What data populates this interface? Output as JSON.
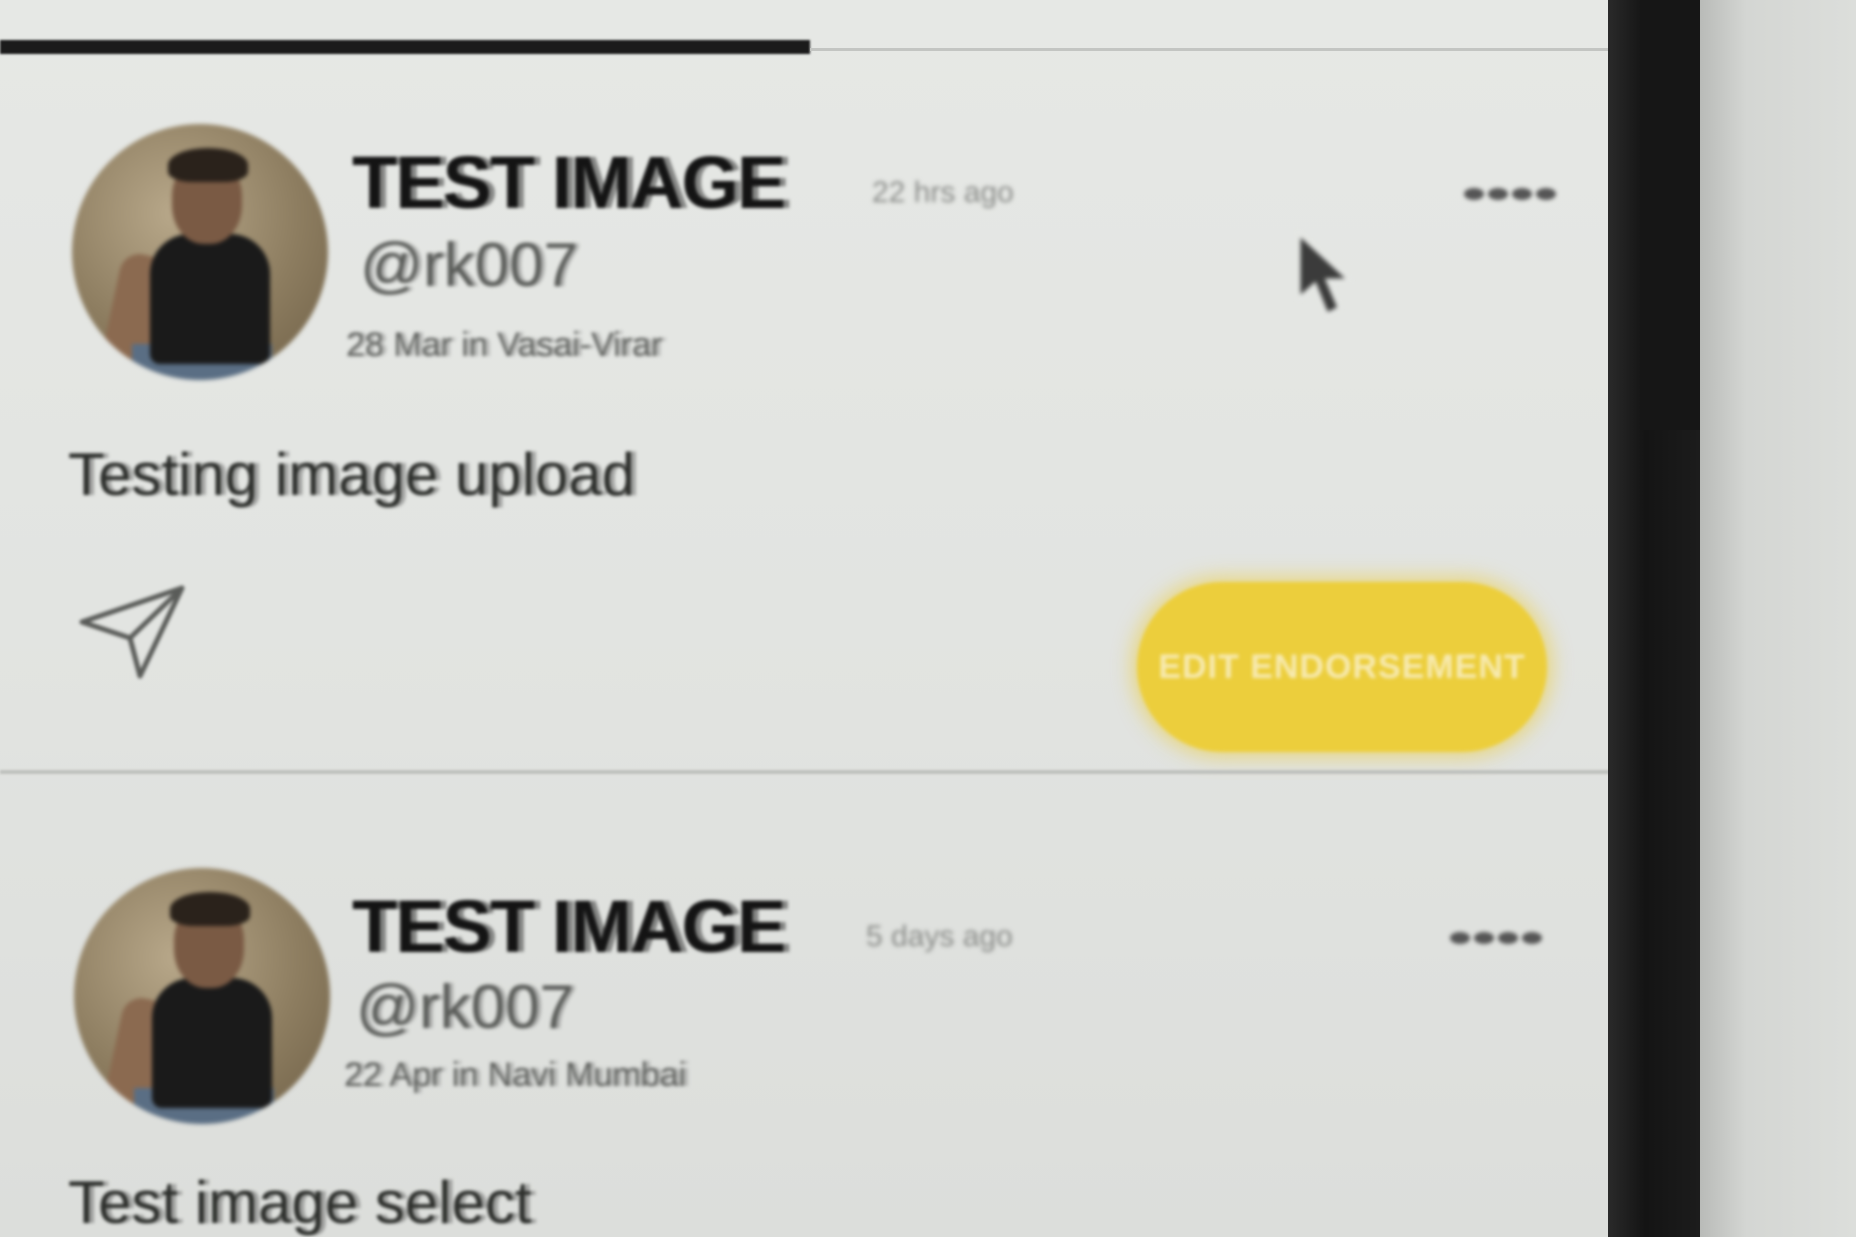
{
  "feed": {
    "posts": [
      {
        "name": "TEST IMAGE",
        "time": "22 hrs ago",
        "handle": "@rk007",
        "meta": "28 Mar in Vasai-Virar",
        "caption": "Testing image upload",
        "action_label": "EDIT ENDORSEMENT",
        "action_color": "#ecce3c"
      },
      {
        "name": "TEST IMAGE",
        "time": "5 days ago",
        "handle": "@rk007",
        "meta": "22 Apr in Navi Mumbai",
        "caption": "Test image select"
      }
    ]
  },
  "icons": {
    "more": "more-dots-icon",
    "share": "paper-plane-icon",
    "avatar": "user-photo"
  },
  "colors": {
    "accent": "#ecce3c",
    "text": "#141414",
    "muted": "#8a8c89"
  }
}
